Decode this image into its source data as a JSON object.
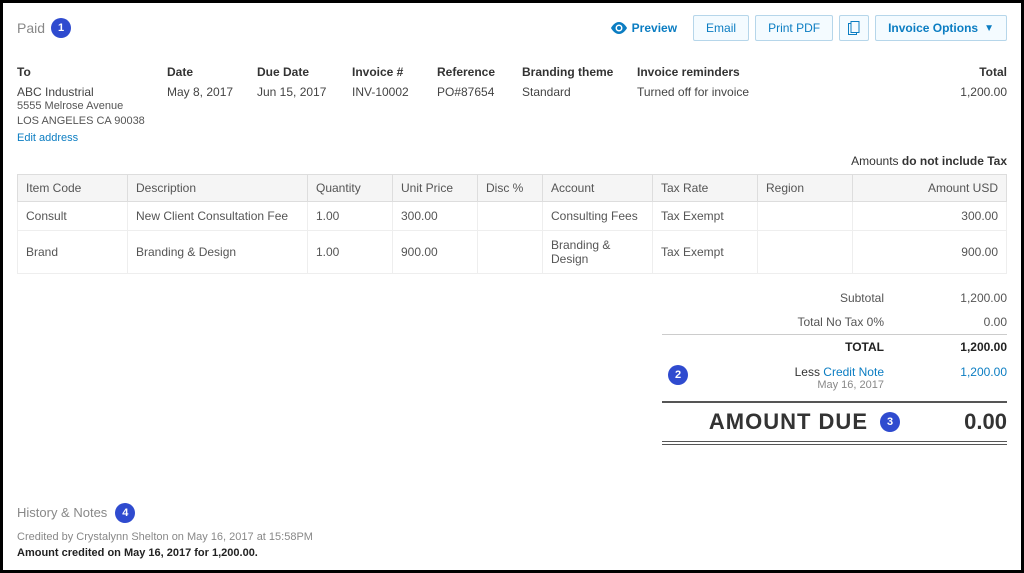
{
  "status": "Paid",
  "toolbar": {
    "preview": "Preview",
    "email": "Email",
    "print_pdf": "Print PDF",
    "invoice_options": "Invoice Options"
  },
  "headers": {
    "to": "To",
    "date": "Date",
    "due_date": "Due Date",
    "invoice_no": "Invoice #",
    "reference": "Reference",
    "branding": "Branding theme",
    "reminders": "Invoice reminders",
    "total": "Total"
  },
  "invoice": {
    "to_name": "ABC Industrial",
    "addr1": "5555 Melrose Avenue",
    "addr2": "LOS ANGELES CA 90038",
    "edit_address": "Edit address",
    "date": "May 8, 2017",
    "due_date": "Jun 15, 2017",
    "invoice_no": "INV-10002",
    "reference": "PO#87654",
    "branding": "Standard",
    "reminders": "Turned off for invoice",
    "total": "1,200.00"
  },
  "amounts_note_prefix": "Amounts ",
  "amounts_note_bold": "do not include Tax",
  "table_headers": {
    "item_code": "Item Code",
    "description": "Description",
    "quantity": "Quantity",
    "unit_price": "Unit Price",
    "disc": "Disc %",
    "account": "Account",
    "tax_rate": "Tax Rate",
    "region": "Region",
    "amount": "Amount USD"
  },
  "lines": [
    {
      "code": "Consult",
      "desc": "New Client Consultation Fee",
      "qty": "1.00",
      "price": "300.00",
      "disc": "",
      "account": "Consulting Fees",
      "tax": "Tax Exempt",
      "region": "",
      "amount": "300.00"
    },
    {
      "code": "Brand",
      "desc": "Branding & Design",
      "qty": "1.00",
      "price": "900.00",
      "disc": "",
      "account": "Branding & Design",
      "tax": "Tax Exempt",
      "region": "",
      "amount": "900.00"
    }
  ],
  "totals": {
    "subtotal_label": "Subtotal",
    "subtotal": "1,200.00",
    "notax_label": "Total No Tax 0%",
    "notax": "0.00",
    "total_label": "TOTAL",
    "total": "1,200.00",
    "less_label": "Less ",
    "credit_note_label": "Credit Note",
    "credit_date": "May 16, 2017",
    "credit_amount": "1,200.00",
    "due_label": "AMOUNT DUE",
    "due": "0.00"
  },
  "history": {
    "title": "History & Notes",
    "line1": "Credited by Crystalynn Shelton on May 16, 2017 at 15:58PM",
    "line2": "Amount credited on May 16, 2017 for 1,200.00."
  },
  "annotations": {
    "1": "1",
    "2": "2",
    "3": "3",
    "4": "4"
  }
}
